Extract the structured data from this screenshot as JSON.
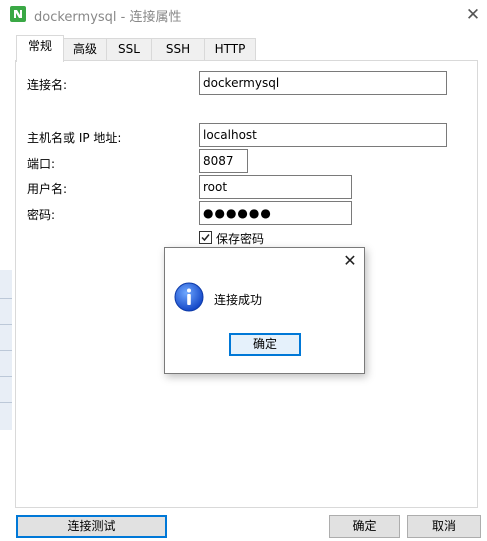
{
  "window": {
    "title": "dockermysql - 连接属性",
    "close_glyph": "✕",
    "app_icon": "navicat-icon",
    "accent": "#0078d7"
  },
  "tabs": [
    {
      "label": "常规",
      "active": true
    },
    {
      "label": "高级",
      "active": false
    },
    {
      "label": "SSL",
      "active": false
    },
    {
      "label": "SSH",
      "active": false
    },
    {
      "label": "HTTP",
      "active": false
    }
  ],
  "form": {
    "conn_name_label": "连接名:",
    "conn_name_value": "dockermysql",
    "host_label": "主机名或 IP 地址:",
    "host_value": "localhost",
    "port_label": "端口:",
    "port_value": "8087",
    "user_label": "用户名:",
    "user_value": "root",
    "password_label": "密码:",
    "password_value": "●●●●●●",
    "save_password_label": "保存密码",
    "save_password_checked": true
  },
  "buttons": {
    "test_connection": "连接测试",
    "ok": "确定",
    "cancel": "取消"
  },
  "message_dialog": {
    "close_glyph": "✕",
    "icon": "info-icon",
    "text": "连接成功",
    "ok": "确定"
  }
}
